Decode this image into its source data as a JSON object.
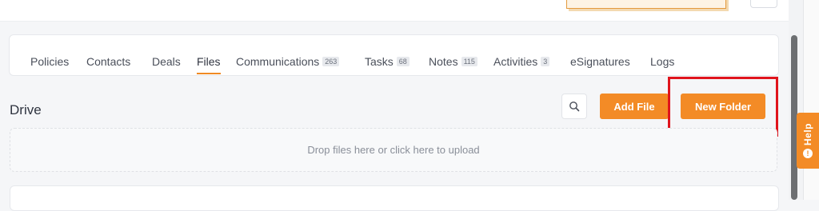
{
  "tabs": [
    {
      "label": "Policies",
      "badge": null,
      "active": false
    },
    {
      "label": "Contacts",
      "badge": null,
      "active": false
    },
    {
      "label": "Deals",
      "badge": null,
      "active": false
    },
    {
      "label": "Files",
      "badge": null,
      "active": true
    },
    {
      "label": "Communications",
      "badge": "263",
      "active": false
    },
    {
      "label": "Tasks",
      "badge": "68",
      "active": false
    },
    {
      "label": "Notes",
      "badge": "115",
      "active": false
    },
    {
      "label": "Activities",
      "badge": "3",
      "active": false
    },
    {
      "label": "eSignatures",
      "badge": null,
      "active": false
    },
    {
      "label": "Logs",
      "badge": null,
      "active": false
    }
  ],
  "drive": {
    "title": "Drive",
    "search_icon": "search-icon",
    "add_file_label": "Add File",
    "new_folder_label": "New Folder",
    "dropzone_text": "Drop files here or click here to upload"
  },
  "help": {
    "label": "Help",
    "icon": "info-icon",
    "icon_glyph": "!"
  },
  "colors": {
    "accent": "#f38b26",
    "highlight": "#e0141c"
  }
}
